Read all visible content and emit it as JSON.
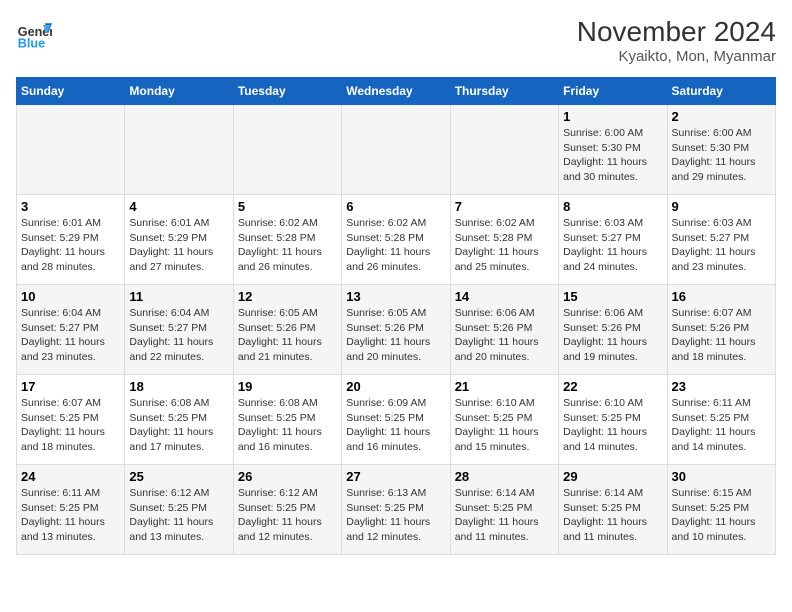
{
  "header": {
    "logo_line1": "General",
    "logo_line2": "Blue",
    "title": "November 2024",
    "subtitle": "Kyaikto, Mon, Myanmar"
  },
  "days_of_week": [
    "Sunday",
    "Monday",
    "Tuesday",
    "Wednesday",
    "Thursday",
    "Friday",
    "Saturday"
  ],
  "weeks": [
    [
      {
        "day": "",
        "info": ""
      },
      {
        "day": "",
        "info": ""
      },
      {
        "day": "",
        "info": ""
      },
      {
        "day": "",
        "info": ""
      },
      {
        "day": "",
        "info": ""
      },
      {
        "day": "1",
        "info": "Sunrise: 6:00 AM\nSunset: 5:30 PM\nDaylight: 11 hours\nand 30 minutes."
      },
      {
        "day": "2",
        "info": "Sunrise: 6:00 AM\nSunset: 5:30 PM\nDaylight: 11 hours\nand 29 minutes."
      }
    ],
    [
      {
        "day": "3",
        "info": "Sunrise: 6:01 AM\nSunset: 5:29 PM\nDaylight: 11 hours\nand 28 minutes."
      },
      {
        "day": "4",
        "info": "Sunrise: 6:01 AM\nSunset: 5:29 PM\nDaylight: 11 hours\nand 27 minutes."
      },
      {
        "day": "5",
        "info": "Sunrise: 6:02 AM\nSunset: 5:28 PM\nDaylight: 11 hours\nand 26 minutes."
      },
      {
        "day": "6",
        "info": "Sunrise: 6:02 AM\nSunset: 5:28 PM\nDaylight: 11 hours\nand 26 minutes."
      },
      {
        "day": "7",
        "info": "Sunrise: 6:02 AM\nSunset: 5:28 PM\nDaylight: 11 hours\nand 25 minutes."
      },
      {
        "day": "8",
        "info": "Sunrise: 6:03 AM\nSunset: 5:27 PM\nDaylight: 11 hours\nand 24 minutes."
      },
      {
        "day": "9",
        "info": "Sunrise: 6:03 AM\nSunset: 5:27 PM\nDaylight: 11 hours\nand 23 minutes."
      }
    ],
    [
      {
        "day": "10",
        "info": "Sunrise: 6:04 AM\nSunset: 5:27 PM\nDaylight: 11 hours\nand 23 minutes."
      },
      {
        "day": "11",
        "info": "Sunrise: 6:04 AM\nSunset: 5:27 PM\nDaylight: 11 hours\nand 22 minutes."
      },
      {
        "day": "12",
        "info": "Sunrise: 6:05 AM\nSunset: 5:26 PM\nDaylight: 11 hours\nand 21 minutes."
      },
      {
        "day": "13",
        "info": "Sunrise: 6:05 AM\nSunset: 5:26 PM\nDaylight: 11 hours\nand 20 minutes."
      },
      {
        "day": "14",
        "info": "Sunrise: 6:06 AM\nSunset: 5:26 PM\nDaylight: 11 hours\nand 20 minutes."
      },
      {
        "day": "15",
        "info": "Sunrise: 6:06 AM\nSunset: 5:26 PM\nDaylight: 11 hours\nand 19 minutes."
      },
      {
        "day": "16",
        "info": "Sunrise: 6:07 AM\nSunset: 5:26 PM\nDaylight: 11 hours\nand 18 minutes."
      }
    ],
    [
      {
        "day": "17",
        "info": "Sunrise: 6:07 AM\nSunset: 5:25 PM\nDaylight: 11 hours\nand 18 minutes."
      },
      {
        "day": "18",
        "info": "Sunrise: 6:08 AM\nSunset: 5:25 PM\nDaylight: 11 hours\nand 17 minutes."
      },
      {
        "day": "19",
        "info": "Sunrise: 6:08 AM\nSunset: 5:25 PM\nDaylight: 11 hours\nand 16 minutes."
      },
      {
        "day": "20",
        "info": "Sunrise: 6:09 AM\nSunset: 5:25 PM\nDaylight: 11 hours\nand 16 minutes."
      },
      {
        "day": "21",
        "info": "Sunrise: 6:10 AM\nSunset: 5:25 PM\nDaylight: 11 hours\nand 15 minutes."
      },
      {
        "day": "22",
        "info": "Sunrise: 6:10 AM\nSunset: 5:25 PM\nDaylight: 11 hours\nand 14 minutes."
      },
      {
        "day": "23",
        "info": "Sunrise: 6:11 AM\nSunset: 5:25 PM\nDaylight: 11 hours\nand 14 minutes."
      }
    ],
    [
      {
        "day": "24",
        "info": "Sunrise: 6:11 AM\nSunset: 5:25 PM\nDaylight: 11 hours\nand 13 minutes."
      },
      {
        "day": "25",
        "info": "Sunrise: 6:12 AM\nSunset: 5:25 PM\nDaylight: 11 hours\nand 13 minutes."
      },
      {
        "day": "26",
        "info": "Sunrise: 6:12 AM\nSunset: 5:25 PM\nDaylight: 11 hours\nand 12 minutes."
      },
      {
        "day": "27",
        "info": "Sunrise: 6:13 AM\nSunset: 5:25 PM\nDaylight: 11 hours\nand 12 minutes."
      },
      {
        "day": "28",
        "info": "Sunrise: 6:14 AM\nSunset: 5:25 PM\nDaylight: 11 hours\nand 11 minutes."
      },
      {
        "day": "29",
        "info": "Sunrise: 6:14 AM\nSunset: 5:25 PM\nDaylight: 11 hours\nand 11 minutes."
      },
      {
        "day": "30",
        "info": "Sunrise: 6:15 AM\nSunset: 5:25 PM\nDaylight: 11 hours\nand 10 minutes."
      }
    ]
  ]
}
